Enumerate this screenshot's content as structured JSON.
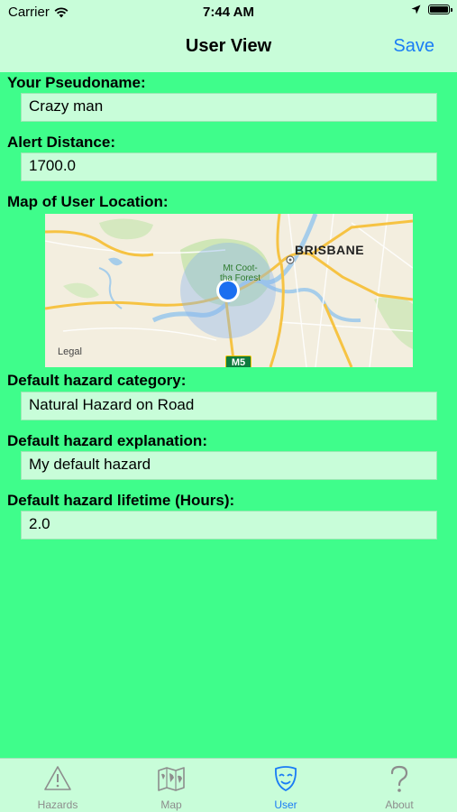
{
  "status_bar": {
    "carrier": "Carrier",
    "time": "7:44 AM"
  },
  "nav": {
    "title": "User View",
    "save_label": "Save"
  },
  "form": {
    "pseudonym_label": "Your Pseudoname:",
    "pseudonym_value": "Crazy man",
    "alert_distance_label": "Alert Distance:",
    "alert_distance_value": "1700.0",
    "map_label": "Map of User Location:",
    "hazard_category_label": "Default hazard category:",
    "hazard_category_value": "Natural Hazard on Road",
    "hazard_explanation_label": "Default hazard explanation:",
    "hazard_explanation_value": "My default hazard",
    "hazard_lifetime_label": "Default hazard lifetime (Hours):",
    "hazard_lifetime_value": "2.0"
  },
  "map": {
    "city": "BRISBANE",
    "suburb": "Mt Coot-tha Forest",
    "road_shield": "M5",
    "legal": "Legal"
  },
  "tabbar": {
    "tabs": [
      {
        "label": "Hazards",
        "icon": "warning-icon"
      },
      {
        "label": "Map",
        "icon": "map-icon"
      },
      {
        "label": "User",
        "icon": "mask-icon"
      },
      {
        "label": "About",
        "icon": "question-icon"
      }
    ],
    "active": "User"
  },
  "colors": {
    "background": "#3ffd8b",
    "field": "#c8fdd9",
    "accent": "#1a7cf5"
  }
}
